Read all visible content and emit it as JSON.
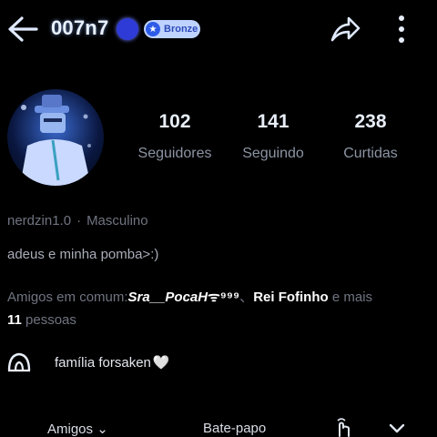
{
  "header": {
    "username": "007n7",
    "badge_label": "Bronze",
    "icons": [
      "back-arrow-icon",
      "sad-face-emoji-icon",
      "bronze-badge-icon",
      "share-icon",
      "more-vertical-icon"
    ]
  },
  "profile": {
    "stats": [
      {
        "value": "102",
        "label": "Seguidores"
      },
      {
        "value": "141",
        "label": "Seguindo"
      },
      {
        "value": "238",
        "label": "Curtidas"
      }
    ],
    "handle": "nerdzin1.0",
    "separator": "·",
    "gender": "Masculino",
    "bio": "adeus e minha pomba>:)"
  },
  "mutual_friends": {
    "prefix": "Amigos em comum:",
    "friend1": "Sra__PocaH",
    "friend1_suffix": "ᯤ⁹⁹⁹",
    "separator": "、",
    "friend2": "Rei Fofinho",
    "middle": " e mais",
    "count": "11",
    "suffix": " pessoas"
  },
  "community": {
    "name": "família forsaken",
    "heart": "🤍"
  },
  "tabs": {
    "friends": "Amigos",
    "friends_chevron": "⌄",
    "chat": "Bate-papo"
  },
  "colors": {
    "background": "#000000",
    "muted_text": "#6f7480",
    "badge_bg": "#bfd3ff",
    "badge_text": "#2d4bb8"
  }
}
